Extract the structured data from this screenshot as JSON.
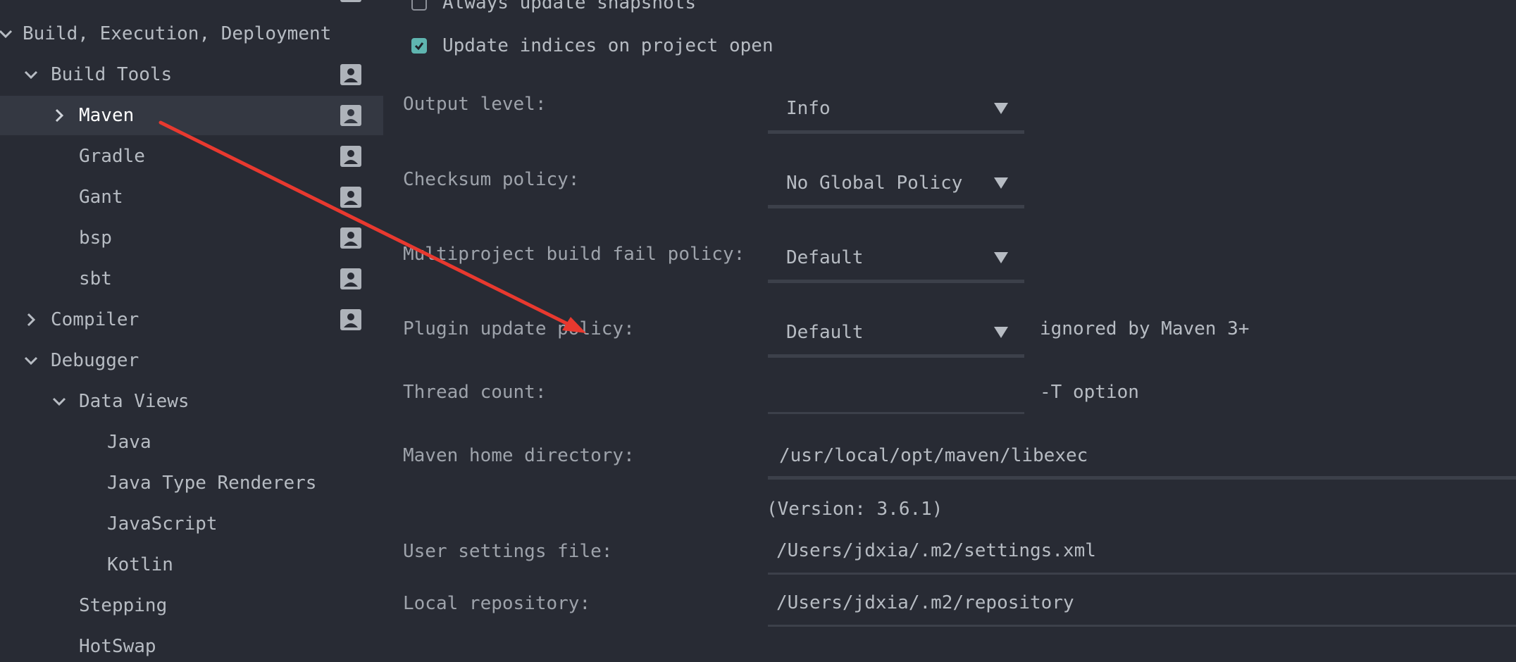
{
  "sidebar": {
    "items": [
      {
        "label": "Build, Execution, Deployment",
        "expanded": true,
        "icon": "chevron-down-icon"
      },
      {
        "label": "Build Tools",
        "expanded": true,
        "icon": "chevron-down-icon"
      },
      {
        "label": "Maven",
        "expanded": false,
        "selected": true,
        "icon": "chevron-right-icon"
      },
      {
        "label": "Gradle"
      },
      {
        "label": "Gant"
      },
      {
        "label": "bsp"
      },
      {
        "label": "sbt"
      },
      {
        "label": "Compiler",
        "expanded": false,
        "icon": "chevron-right-icon"
      },
      {
        "label": "Debugger",
        "expanded": true,
        "icon": "chevron-down-icon"
      },
      {
        "label": "Data Views",
        "expanded": true,
        "icon": "chevron-down-icon"
      },
      {
        "label": "Java"
      },
      {
        "label": "Java Type Renderers"
      },
      {
        "label": "JavaScript"
      },
      {
        "label": "Kotlin"
      },
      {
        "label": "Stepping"
      },
      {
        "label": "HotSwap"
      }
    ]
  },
  "checkboxes": {
    "always_update_snapshots": {
      "label": "Always update snapshots",
      "checked": false
    },
    "update_indices": {
      "label": "Update indices on project open",
      "checked": true
    }
  },
  "form": {
    "output_level": {
      "label": "Output level:",
      "value": "Info"
    },
    "checksum_policy": {
      "label": "Checksum policy:",
      "value": "No Global Policy"
    },
    "multiproject_fail_policy": {
      "label": "Multiproject build fail policy:",
      "value": "Default"
    },
    "plugin_update_policy": {
      "label": "Plugin update policy:",
      "value": "Default",
      "hint": "ignored by Maven 3+"
    },
    "thread_count": {
      "label": "Thread count:",
      "value": "",
      "hint": "-T option"
    },
    "maven_home": {
      "label": "Maven home directory:",
      "value": "/usr/local/opt/maven/libexec",
      "version": "(Version: 3.6.1)"
    },
    "user_settings": {
      "label": "User settings file:",
      "value": "/Users/jdxia/.m2/settings.xml"
    },
    "local_repository": {
      "label": "Local repository:",
      "value": "/Users/jdxia/.m2/repository"
    }
  },
  "colors": {
    "background": "#282b34",
    "selected_row": "#343842",
    "text": "#b7bcc3",
    "checkbox_checked": "#5fb5b0",
    "annotation_arrow": "#e8392f"
  }
}
